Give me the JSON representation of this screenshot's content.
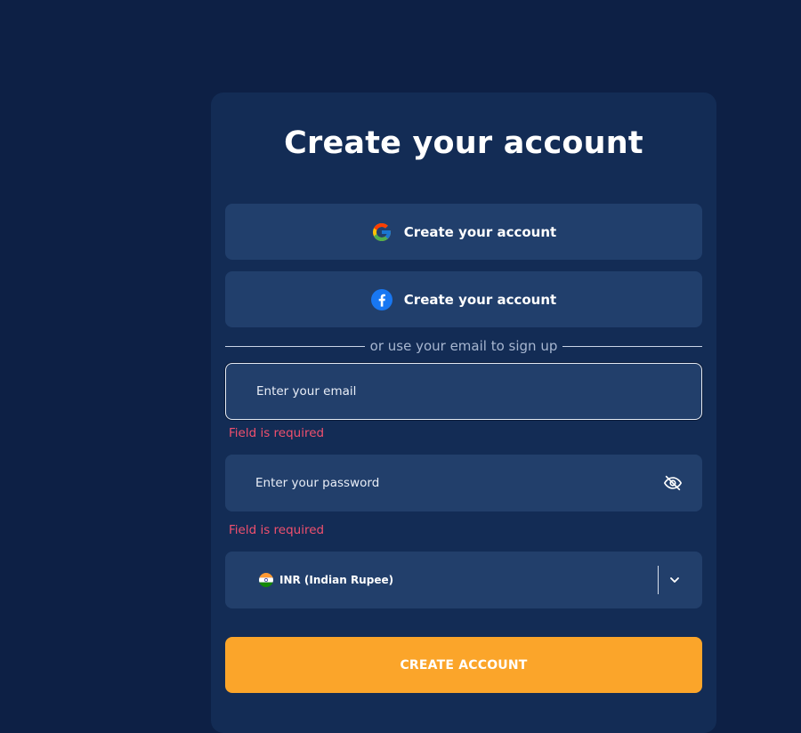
{
  "page": {
    "title": "Create your account"
  },
  "social": {
    "google_label": "Create your account",
    "facebook_label": "Create your account"
  },
  "divider": {
    "text": "or use your email to sign up"
  },
  "email": {
    "placeholder": "Enter your email",
    "value": "",
    "error": "Field is required"
  },
  "password": {
    "placeholder": "Enter your password",
    "value": "",
    "error": "Field is required",
    "toggle_icon": "eye-off-icon"
  },
  "currency": {
    "selected": "INR (Indian Rupee)",
    "flag_icon": "india-flag-icon",
    "dropdown_icon": "chevron-down-icon"
  },
  "submit": {
    "label": "CREATE ACCOUNT"
  },
  "colors": {
    "page_bg": "#0d2045",
    "card_bg": "#132c55",
    "field_bg": "#223f6b",
    "accent": "#fba52a",
    "error": "#f0506e"
  }
}
